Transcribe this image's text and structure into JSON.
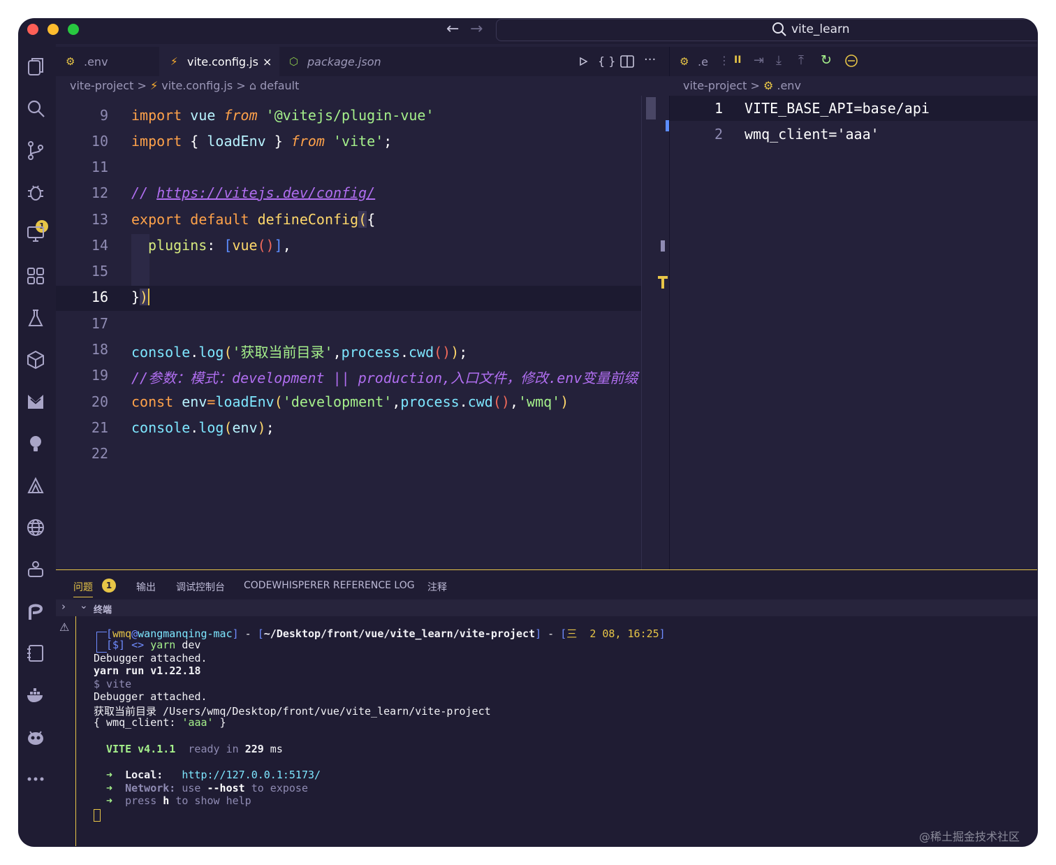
{
  "titlebar": {
    "search_text": "vite_learn",
    "back_icon": "←",
    "forward_icon": "→"
  },
  "tabs": [
    {
      "icon": "env-file-icon",
      "label": ".env"
    },
    {
      "icon": "vite-icon",
      "label": "vite.config.js",
      "close": "×"
    },
    {
      "icon": "node-package-icon",
      "label": "package.json"
    }
  ],
  "breadcrumb_left": {
    "project": "vite-project",
    "file": "vite.config.js",
    "symbol": "default",
    "sep": ">"
  },
  "breadcrumb_right": {
    "project": "vite-project",
    "file": ".env",
    "sep": ">"
  },
  "right_tab_label": ".e",
  "activity_badge": "1",
  "editor": {
    "line_numbers": [
      "9",
      "10",
      "11",
      "12",
      "13",
      "14",
      "15",
      "16",
      "17",
      "18",
      "19",
      "20",
      "21",
      "22"
    ],
    "lines": {
      "l9": [
        "import",
        " vue ",
        "from",
        " '@vitejs/plugin-vue'"
      ],
      "l10": [
        "import",
        " { ",
        "loadEnv",
        " } ",
        "from",
        " 'vite'",
        ";"
      ],
      "l12": [
        "// ",
        "https://vitejs.dev/config/"
      ],
      "l13": [
        "export",
        " ",
        "default",
        " ",
        "defineConfig",
        "(",
        "{"
      ],
      "l14": [
        "plugins",
        ": ",
        "[",
        "vue",
        "()",
        "]",
        ","
      ],
      "l16": [
        "}",
        ")"
      ],
      "l18": [
        "console",
        ".",
        "log",
        "(",
        "'获取当前目录'",
        ",",
        "process",
        ".",
        "cwd",
        "()",
        ")",
        ";"
      ],
      "l19": "//参数：模式：development || production,入口文件，修改.env变量前缀",
      "l20": [
        "const",
        " ",
        "env",
        "=",
        "loadEnv",
        "(",
        "'development'",
        ",",
        "process",
        ".",
        "cwd",
        "()",
        ",",
        "'wmq'",
        ")"
      ],
      "l21": [
        "console",
        ".",
        "log",
        "(",
        "env",
        ")",
        ";"
      ]
    }
  },
  "env_file": {
    "line_numbers": [
      "1",
      "2"
    ],
    "lines": [
      "VITE_BASE_API=base/api",
      "wmq_client='aaa'"
    ]
  },
  "panel": {
    "tabs": [
      "问题",
      "输出",
      "调试控制台",
      "CODEWHISPERER REFERENCE LOG",
      "注释"
    ],
    "problems_badge": "1",
    "terminal_title": "终端"
  },
  "terminal": {
    "prompt_user": "wmq",
    "prompt_at": "@",
    "prompt_host": "wangmanqing-mac",
    "prompt_path": "~/Desktop/front/vue/vite_learn/vite-project",
    "prompt_time": "三  2 08, 16:25",
    "dash": " - ",
    "dollar": "[$]",
    "arrows": "<>",
    "cmd1": "yarn",
    "cmd2": " dev",
    "out1": "Debugger attached.",
    "out2": "yarn run v1.22.18",
    "out3": "$ vite",
    "out4": "Debugger attached.",
    "out5_label": "获取当前目录",
    "out5_path": " /Users/wmq/Desktop/front/vue/vite_learn/vite-project",
    "out6_a": "{ wmq_client: ",
    "out6_b": "'aaa'",
    "out6_c": " }",
    "vite_name": "VITE v4.1.1",
    "vite_ready": "  ready in ",
    "vite_ms_num": "229",
    "vite_ms": " ms",
    "local_arrow": "➜",
    "local_label": "  Local:   ",
    "local_url": "http://127.0.0.1:5173/",
    "network_label": "  Network: ",
    "network_use": "use ",
    "network_host": "--host",
    "network_rest": " to expose",
    "help_a": "  press ",
    "help_h": "h",
    "help_b": " to show help"
  },
  "watermark": "@稀土掘金技术社区",
  "colors": {
    "background": "#24213a",
    "accent_yellow": "#e7c547",
    "keyword": "#ffa24a",
    "string": "#a5f08b",
    "comment": "#b06ef0"
  }
}
